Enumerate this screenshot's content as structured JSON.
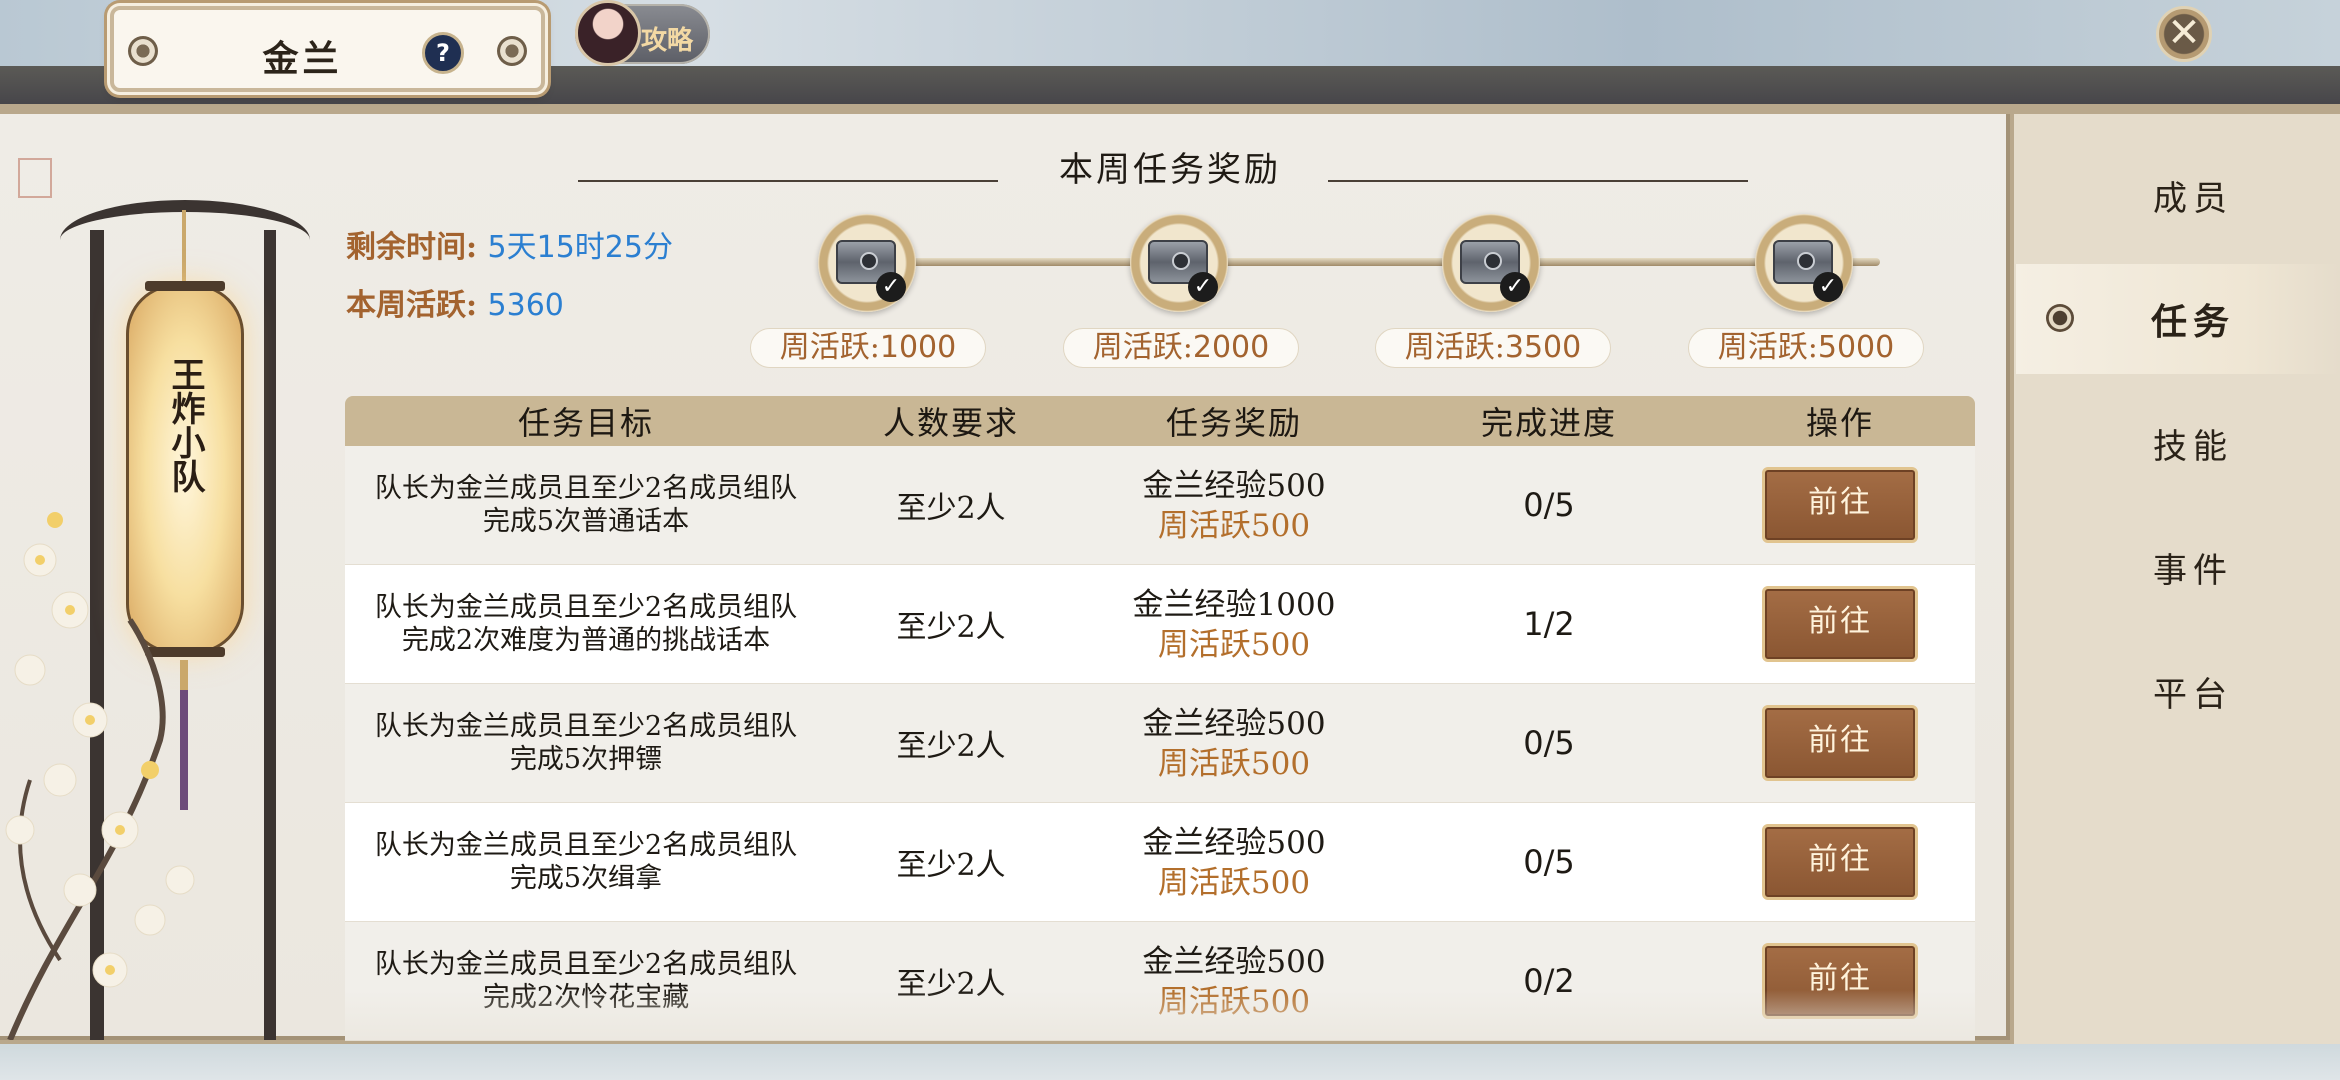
{
  "header": {
    "title": "金兰",
    "help_label": "?",
    "guide_label": "攻略",
    "close_label": "✕"
  },
  "team": {
    "name": "王炸小队"
  },
  "stats": {
    "remaining_label": "剩余时间:",
    "remaining_value": "5天15时25分",
    "activity_label": "本周活跃:",
    "activity_value": "5360"
  },
  "rewards": {
    "title": "本周任务奖励",
    "milestones": [
      {
        "label": "周活跃:",
        "value": "1000",
        "claimed": true
      },
      {
        "label": "周活跃:",
        "value": "2000",
        "claimed": true
      },
      {
        "label": "周活跃:",
        "value": "3500",
        "claimed": true
      },
      {
        "label": "周活跃:",
        "value": "5000",
        "claimed": true
      }
    ]
  },
  "table": {
    "headers": {
      "goal": "任务目标",
      "people": "人数要求",
      "reward": "任务奖励",
      "progress": "完成进度",
      "action": "操作"
    },
    "rows": [
      {
        "goal_line1": "队长为金兰成员且至少2名成员组队",
        "goal_line2": "完成5次普通话本",
        "people": "至少2人",
        "exp": "金兰经验500",
        "activity": "周活跃500",
        "progress": "0/5",
        "action": "前往"
      },
      {
        "goal_line1": "队长为金兰成员且至少2名成员组队",
        "goal_line2": "完成2次难度为普通的挑战话本",
        "people": "至少2人",
        "exp": "金兰经验1000",
        "activity": "周活跃500",
        "progress": "1/2",
        "action": "前往"
      },
      {
        "goal_line1": "队长为金兰成员且至少2名成员组队",
        "goal_line2": "完成5次押镖",
        "people": "至少2人",
        "exp": "金兰经验500",
        "activity": "周活跃500",
        "progress": "0/5",
        "action": "前往"
      },
      {
        "goal_line1": "队长为金兰成员且至少2名成员组队",
        "goal_line2": "完成5次缉拿",
        "people": "至少2人",
        "exp": "金兰经验500",
        "activity": "周活跃500",
        "progress": "0/5",
        "action": "前往"
      },
      {
        "goal_line1": "队长为金兰成员且至少2名成员组队",
        "goal_line2": "完成2次怜花宝藏",
        "people": "至少2人",
        "exp": "金兰经验500",
        "activity": "周活跃500",
        "progress": "0/2",
        "action": "前往"
      }
    ]
  },
  "sidebar": {
    "items": [
      {
        "label": "成员",
        "active": false
      },
      {
        "label": "任务",
        "active": true
      },
      {
        "label": "技能",
        "active": false
      },
      {
        "label": "事件",
        "active": false
      },
      {
        "label": "平台",
        "active": false
      }
    ]
  },
  "colors": {
    "accent_orange": "#a3632f",
    "value_blue": "#2b7fd1",
    "button_brown": "#9a6340"
  }
}
